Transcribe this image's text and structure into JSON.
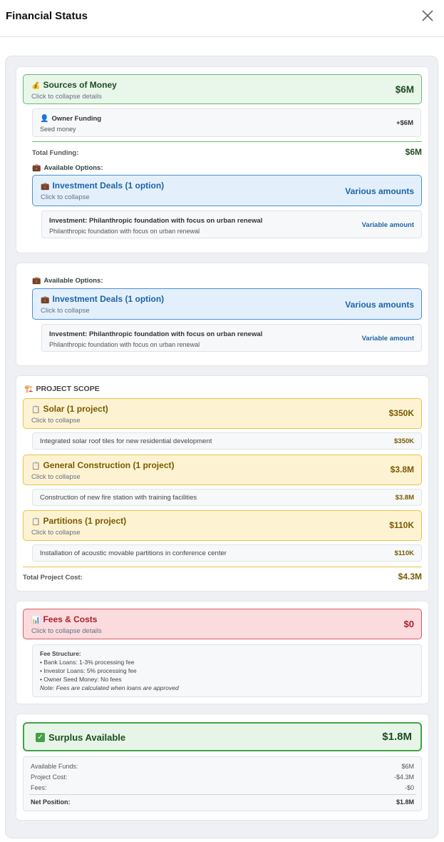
{
  "modal": {
    "title": "Financial Status"
  },
  "sources": {
    "title": "Sources of Money",
    "subtitle": "Click to collapse details",
    "amount": "$6M",
    "owner": {
      "title": "Owner Funding",
      "subtitle": "Seed money",
      "amount": "+$6M"
    },
    "total_label": "Total Funding:",
    "total_amount": "$6M",
    "options_label": "Available Options:",
    "deals": {
      "title": "Investment Deals (1 option)",
      "subtitle": "Click to collapse",
      "amount": "Various amounts",
      "item": {
        "title": "Investment: Philanthropic foundation with focus on urban renewal",
        "subtitle": "Philanthropic foundation with focus on urban renewal",
        "amount": "Variable amount"
      }
    }
  },
  "options2": {
    "options_label": "Available Options:",
    "deals": {
      "title": "Investment Deals (1 option)",
      "subtitle": "Click to collapse",
      "amount": "Various amounts",
      "item": {
        "title": "Investment: Philanthropic foundation with focus on urban renewal",
        "subtitle": "Philanthropic foundation with focus on urban renewal",
        "amount": "Variable amount"
      }
    }
  },
  "scope": {
    "title": "PROJECT SCOPE",
    "groups": [
      {
        "title": "Solar (1 project)",
        "subtitle": "Click to collapse",
        "amount": "$350K",
        "item": "Integrated solar roof tiles for new residential development",
        "item_amount": "$350K"
      },
      {
        "title": "General Construction (1 project)",
        "subtitle": "Click to collapse",
        "amount": "$3.8M",
        "item": "Construction of new fire station with training facilities",
        "item_amount": "$3.8M"
      },
      {
        "title": "Partitions (1 project)",
        "subtitle": "Click to collapse",
        "amount": "$110K",
        "item": "Installation of acoustic movable partitions in conference center",
        "item_amount": "$110K"
      }
    ],
    "total_label": "Total Project Cost:",
    "total_amount": "$4.3M"
  },
  "fees": {
    "title": "Fees & Costs",
    "subtitle": "Click to collapse details",
    "amount": "$0",
    "structure_title": "Fee Structure:",
    "lines": [
      "• Bank Loans: 1-3% processing fee",
      "• Investor Loans: 5% processing fee",
      "• Owner Seed Money: No fees"
    ],
    "note": "Note: Fees are calculated when loans are approved"
  },
  "surplus": {
    "title": "Surplus Available",
    "amount": "$1.8M",
    "rows": [
      {
        "label": "Available Funds:",
        "value": "$6M"
      },
      {
        "label": "Project Cost:",
        "value": "-$4.3M"
      },
      {
        "label": "Fees:",
        "value": "-$0"
      }
    ],
    "net_label": "Net Position:",
    "net_value": "$1.8M"
  },
  "colors": {
    "green": "#43a047",
    "blue": "#1e64a8",
    "yellow": "#7a5a00",
    "red": "#a5242e"
  }
}
